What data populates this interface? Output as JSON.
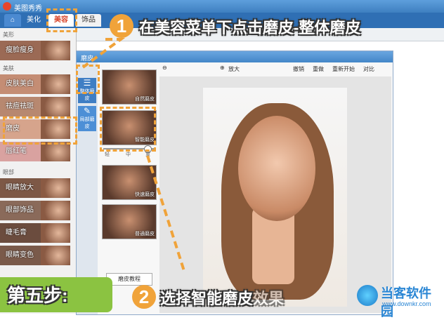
{
  "app": {
    "title": "美图秀秀"
  },
  "tabs": [
    "美化",
    "美容",
    "饰品"
  ],
  "sidebar": {
    "sections": [
      "美形",
      "美肤",
      "眼部"
    ],
    "items": [
      "瘦脸瘦身",
      "皮肤美白",
      "祛痘祛斑",
      "磨皮",
      "唇红笔",
      "眼睛放大",
      "眼部饰品",
      "睫毛膏",
      "眼睛变色"
    ]
  },
  "dialog": {
    "title": "磨皮",
    "tools": [
      "整体磨皮",
      "局部磨皮"
    ],
    "presets": [
      "自然磨皮",
      "智能磨皮",
      "快速磨皮",
      "普通磨皮"
    ],
    "slider_labels": [
      "轻",
      "中",
      "重"
    ],
    "tutorial_button": "磨皮教程",
    "toolbar": [
      "放大",
      "撤销",
      "重做",
      "重新开始",
      "对比"
    ]
  },
  "annotations": {
    "step1_num": "1",
    "step1_text": "在美容菜单下点击磨皮-整体磨皮",
    "step2_num": "2",
    "step2_text": "选择智能磨皮",
    "step2_suffix": "效果",
    "step_badge": "第五步:"
  },
  "watermark": {
    "name": "当客软件园",
    "url": "www.downkr.com"
  }
}
